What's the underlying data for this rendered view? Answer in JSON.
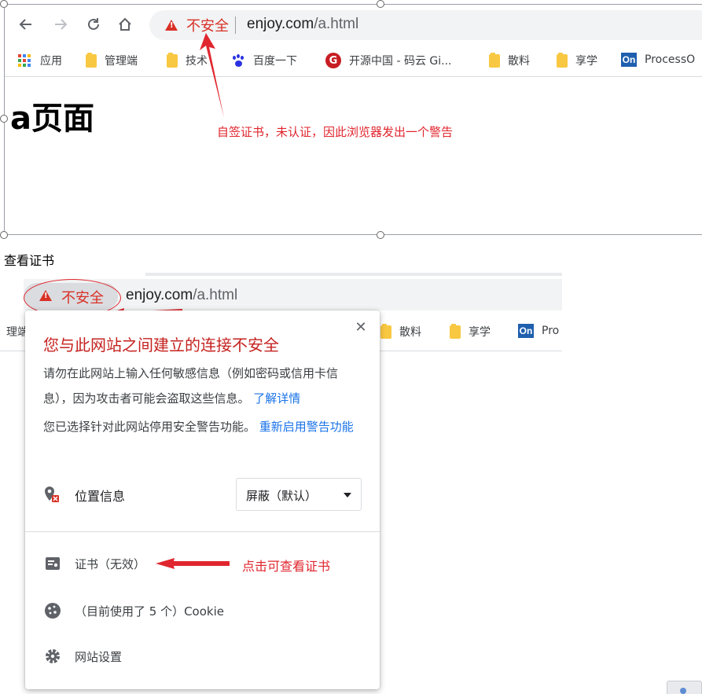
{
  "browser_top": {
    "omnibox": {
      "security_label": "不安全",
      "url_host": "enjoy.com",
      "url_path": "/a.html"
    },
    "bookmarks": [
      {
        "label": "应用",
        "icon": "apps-grid-icon"
      },
      {
        "label": "管理端",
        "icon": "folder-icon"
      },
      {
        "label": "技术",
        "icon": "folder-icon"
      },
      {
        "label": "百度一下",
        "icon": "baidu-icon"
      },
      {
        "label": "开源中国 - 码云 Gi...",
        "icon": "gitee-icon"
      },
      {
        "label": "散料",
        "icon": "folder-icon"
      },
      {
        "label": "享学",
        "icon": "folder-icon"
      },
      {
        "label": "ProcessO",
        "icon": "onenote-icon"
      }
    ],
    "page_heading": "a页面"
  },
  "annotations": {
    "top_note": "自签证书，未认证，因此浏览器发出一个警告",
    "cert_note": "点击可查看证书"
  },
  "section_label": "查看证书",
  "browser_bottom": {
    "chip_label": "不安全",
    "url_host": "enjoy.com",
    "url_path": "/a.html",
    "bookmarks": [
      {
        "label": "理端"
      },
      {
        "label": "散料"
      },
      {
        "label": "享学"
      },
      {
        "label": "Pro"
      }
    ]
  },
  "popup": {
    "title": "您与此网站之间建立的连接不安全",
    "warning_text": "请勿在此网站上输入任何敏感信息（例如密码或信用卡信息），因为攻击者可能会盗取这些信息。",
    "learn_more": "了解详情",
    "disabled_text": "您已选择针对此网站停用安全警告功能。",
    "reenable_link": "重新启用警告功能",
    "permission": {
      "label": "位置信息",
      "selected": "屏蔽（默认）"
    },
    "certificate_label": "证书（无效）",
    "cookies_label": "（目前使用了 5 个）Cookie",
    "site_settings_label": "网站设置"
  },
  "colors": {
    "insecure_red": "#d93025",
    "annotation_red": "#e0262e",
    "link_blue": "#1a73e8",
    "omnibox_gray": "#f1f3f4"
  }
}
